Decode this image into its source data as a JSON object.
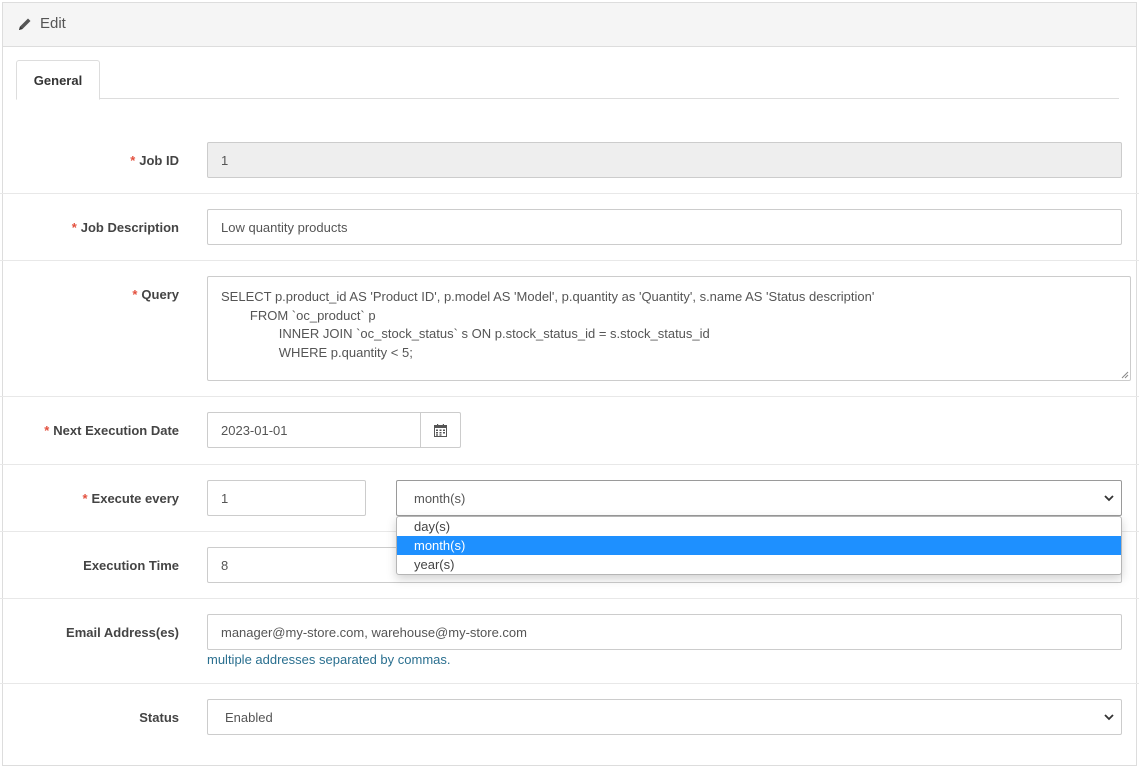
{
  "header": {
    "title": "Edit",
    "icon": "pencil-icon"
  },
  "tabs": [
    {
      "label": "General"
    }
  ],
  "form": {
    "job_id": {
      "label": "Job ID",
      "required": true,
      "value": "1"
    },
    "job_description": {
      "label": "Job Description",
      "required": true,
      "value": "Low quantity products"
    },
    "query": {
      "label": "Query",
      "required": true,
      "value": "SELECT p.product_id AS 'Product ID', p.model AS 'Model', p.quantity as 'Quantity', s.name AS 'Status description'\n        FROM `oc_product` p\n                INNER JOIN `oc_stock_status` s ON p.stock_status_id = s.stock_status_id\n                WHERE p.quantity < 5;"
    },
    "next_execution_date": {
      "label": "Next Execution Date",
      "required": true,
      "value": "2023-01-01",
      "button_icon": "calendar-icon"
    },
    "execute_every": {
      "label": "Execute every",
      "required": true,
      "value": "1",
      "unit_selected": "month(s)",
      "unit_options": [
        "day(s)",
        "month(s)",
        "year(s)"
      ]
    },
    "execution_time": {
      "label": "Execution Time",
      "value": "8"
    },
    "email_addresses": {
      "label": "Email Address(es)",
      "value": "manager@my-store.com, warehouse@my-store.com",
      "help": "multiple addresses separated by commas."
    },
    "status": {
      "label": "Status",
      "value": "Enabled"
    }
  },
  "colors": {
    "required_marker": "#e3503e",
    "dropdown_highlight": "#1e90ff",
    "help_text": "#2a6f8f"
  }
}
